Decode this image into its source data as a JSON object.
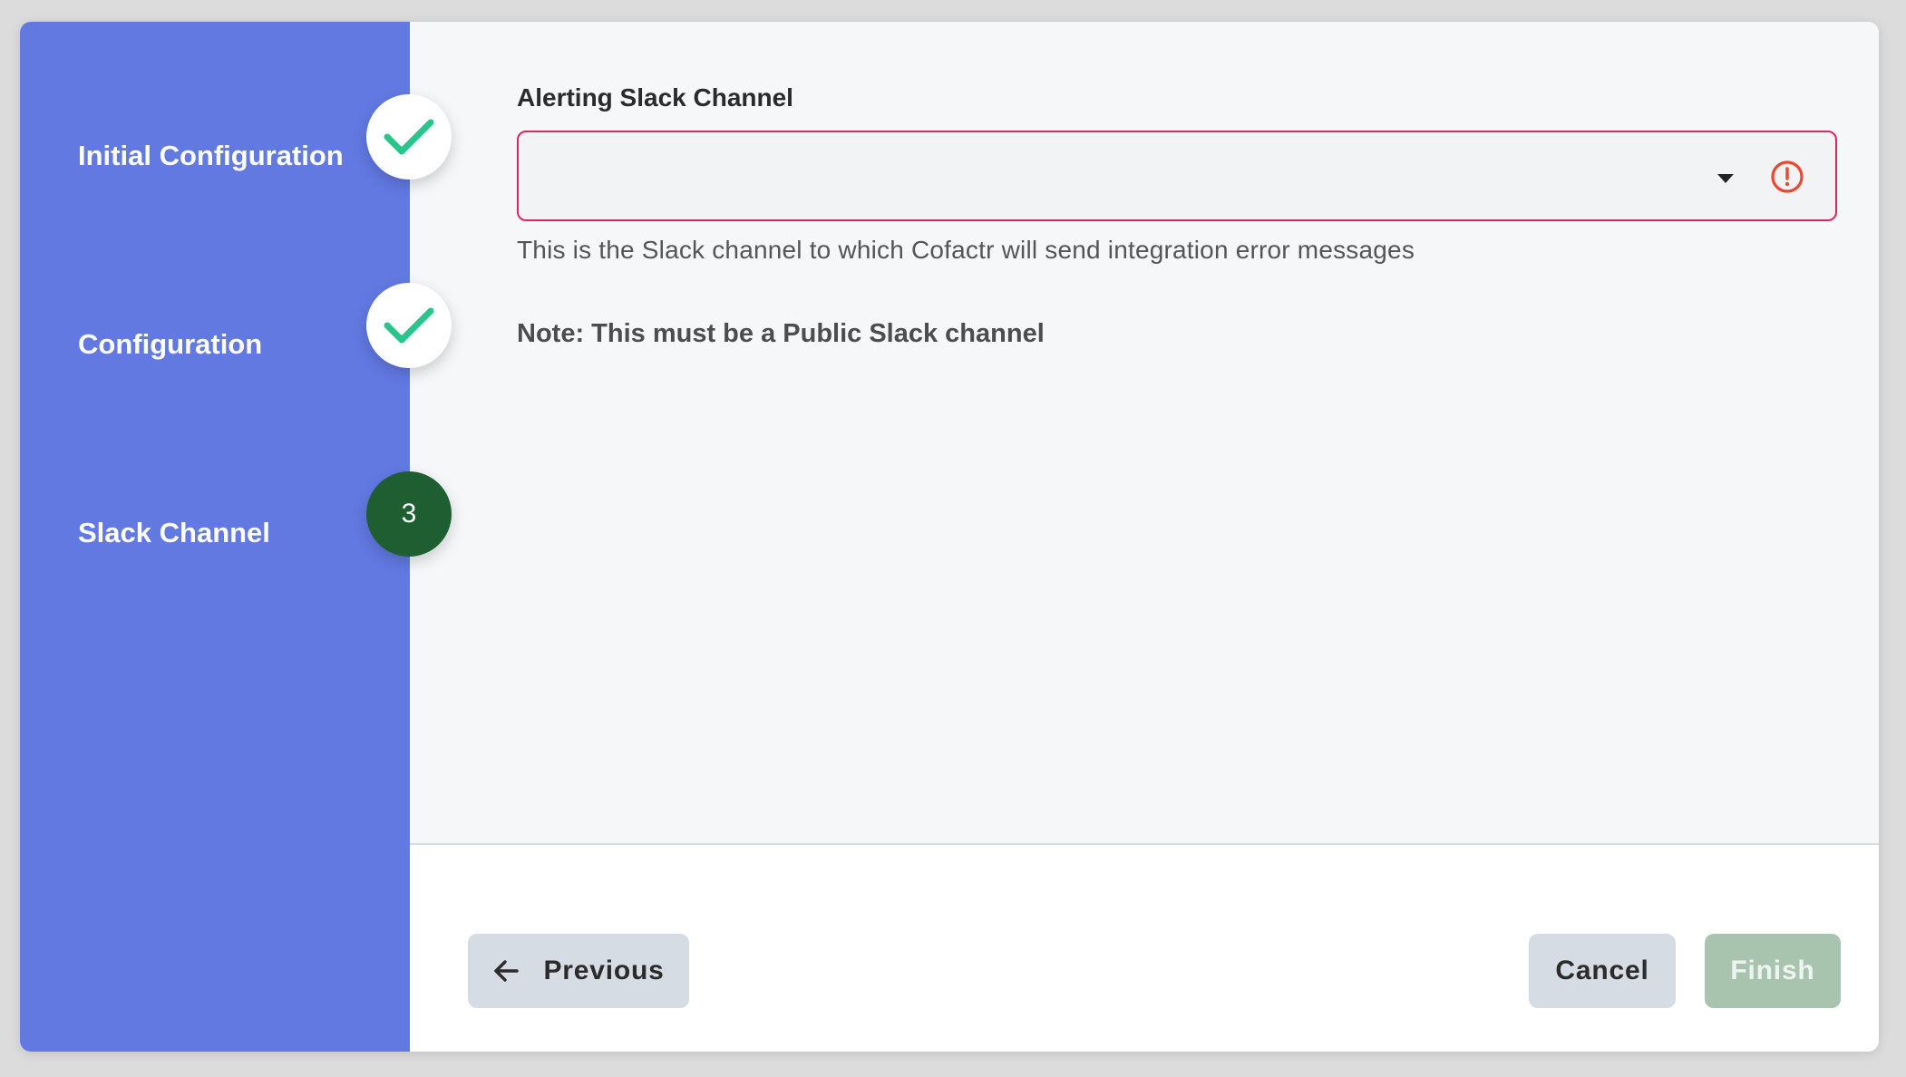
{
  "sidebar": {
    "steps": [
      {
        "label": "Initial Configuration",
        "status": "complete",
        "icon": "check-icon"
      },
      {
        "label": "Configuration",
        "status": "complete",
        "icon": "check-icon"
      },
      {
        "label": "Slack Channel",
        "status": "active",
        "number": "3"
      }
    ]
  },
  "form": {
    "field_label": "Alerting Slack Channel",
    "selected_value": "",
    "helper_text": "This is the Slack channel to which Cofactr will send integration error messages",
    "note": "Note: This must be a Public Slack channel"
  },
  "footer": {
    "previous_label": "Previous",
    "cancel_label": "Cancel",
    "finish_label": "Finish"
  },
  "colors": {
    "sidebar_bg": "#6279e2",
    "check": "#2bc48a",
    "active_step": "#1f5e30",
    "error_border": "#e0245e",
    "error_icon": "#e8492f",
    "finish_disabled": "#a9c4ae"
  }
}
